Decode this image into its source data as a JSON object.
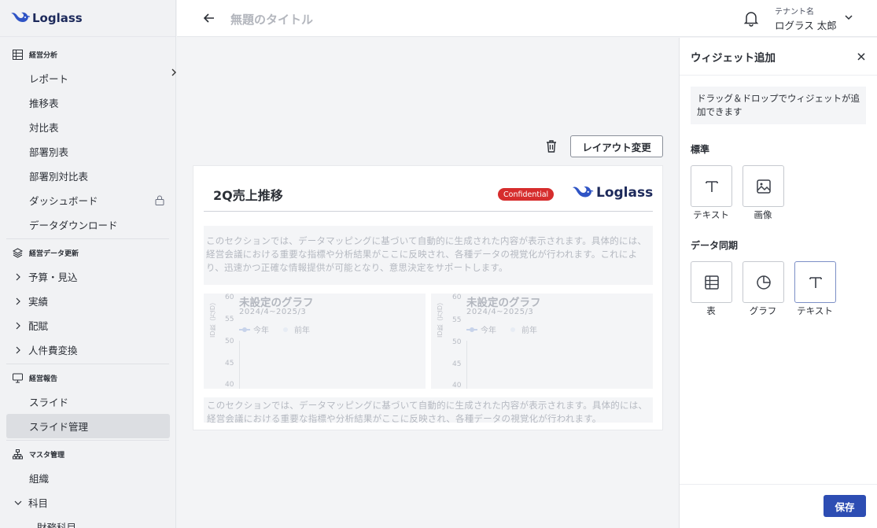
{
  "brand": {
    "name": "Loglass"
  },
  "header": {
    "page_title": "無題のタイトル",
    "tenant_label": "テナント名",
    "user_name": "ログラス 太郎"
  },
  "sidebar": {
    "sections": [
      {
        "title": "経営分析",
        "icon": "table-icon",
        "items": [
          "レポート",
          "推移表",
          "対比表",
          "部署別表",
          "部署別対比表",
          "ダッシュボード",
          "データダウンロード"
        ]
      },
      {
        "title": "経営データ更新",
        "icon": "layers-icon",
        "items": [
          "予算・見込",
          "実績",
          "配賦",
          "人件費変換"
        ]
      },
      {
        "title": "経営報告",
        "icon": "monitor-icon",
        "items": [
          "スライド",
          "スライド管理"
        ]
      },
      {
        "title": "マスタ管理",
        "icon": "org-icon",
        "items": [
          "組織",
          "科目",
          "財務科目"
        ]
      }
    ]
  },
  "toolbar": {
    "layout_button": "レイアウト変更"
  },
  "slide": {
    "title": "2Q売上推移",
    "badge": "Confidential",
    "logo": "Loglass",
    "paragraph1": "このセクションでは、データマッピングに基づいて自動的に生成された内容が表示されます。具体的には、経営会議における重要な指標や分析結果がここに反映され、各種データの視覚化が行われます。これにより、迅速かつ正確な情報提供が可能となり、意思決定をサポートします。",
    "paragraph2": "このセクションでは、データマッピングに基づいて自動的に生成された内容が表示されます。具体的には、経営会議における重要な指標や分析結果がここに反映され、各種データの視覚化が行われます。",
    "charts": [
      {
        "title": "未設定のグラフ",
        "period": "2024/4~2025/3",
        "ylabel": "ID数（万ID）",
        "yticks": [
          "60",
          "55",
          "50",
          "45",
          "40"
        ],
        "legend": [
          "今年",
          "前年"
        ]
      },
      {
        "title": "未設定のグラフ",
        "period": "2024/4~2025/3",
        "ylabel": "ID数（万ID）",
        "yticks": [
          "60",
          "55",
          "50",
          "45",
          "40"
        ],
        "legend": [
          "今年",
          "前年"
        ]
      }
    ]
  },
  "panel": {
    "title": "ウィジェット追加",
    "hint": "ドラッグ＆ドロップでウィジェットが追加できます",
    "group_standard": "標準",
    "group_sync": "データ同期",
    "standard_widgets": [
      {
        "label": "テキスト",
        "icon": "text-icon"
      },
      {
        "label": "画像",
        "icon": "image-icon"
      }
    ],
    "sync_widgets": [
      {
        "label": "表",
        "icon": "table-icon"
      },
      {
        "label": "グラフ",
        "icon": "pie-chart-icon"
      },
      {
        "label": "テキスト",
        "icon": "text-icon"
      }
    ],
    "save_label": "保存"
  },
  "colors": {
    "primary": "#2d4db3",
    "badge": "#d62d2d",
    "brand_navy": "#1d2a5b"
  }
}
